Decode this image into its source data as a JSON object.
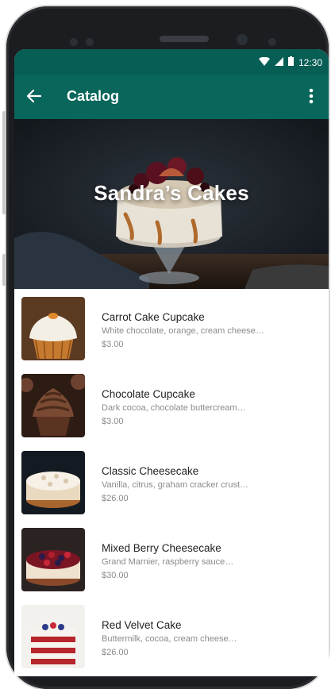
{
  "status_bar": {
    "time": "12:30"
  },
  "toolbar": {
    "title": "Catalog"
  },
  "hero": {
    "title": "Sandra’s Cakes"
  },
  "products": [
    {
      "name": "Carrot Cake Cupcake",
      "description": "White chocolate, orange, cream cheese…",
      "price": "$3.00"
    },
    {
      "name": "Chocolate Cupcake",
      "description": "Dark cocoa, chocolate buttercream…",
      "price": "$3.00"
    },
    {
      "name": "Classic Cheesecake",
      "description": "Vanilla, citrus, graham cracker crust…",
      "price": "$26.00"
    },
    {
      "name": "Mixed Berry Cheesecake",
      "description": "Grand Marnier, raspberry sauce…",
      "price": "$30.00"
    },
    {
      "name": "Red Velvet Cake",
      "description": "Buttermilk, cocoa, cream cheese…",
      "price": "$26.00"
    }
  ],
  "colors": {
    "header": "#075e54",
    "toolbar": "#08665a"
  },
  "icons": {
    "back": "arrow-back-icon",
    "more": "more-vert-icon",
    "wifi": "wifi-icon",
    "signal": "signal-icon",
    "battery": "battery-icon"
  }
}
